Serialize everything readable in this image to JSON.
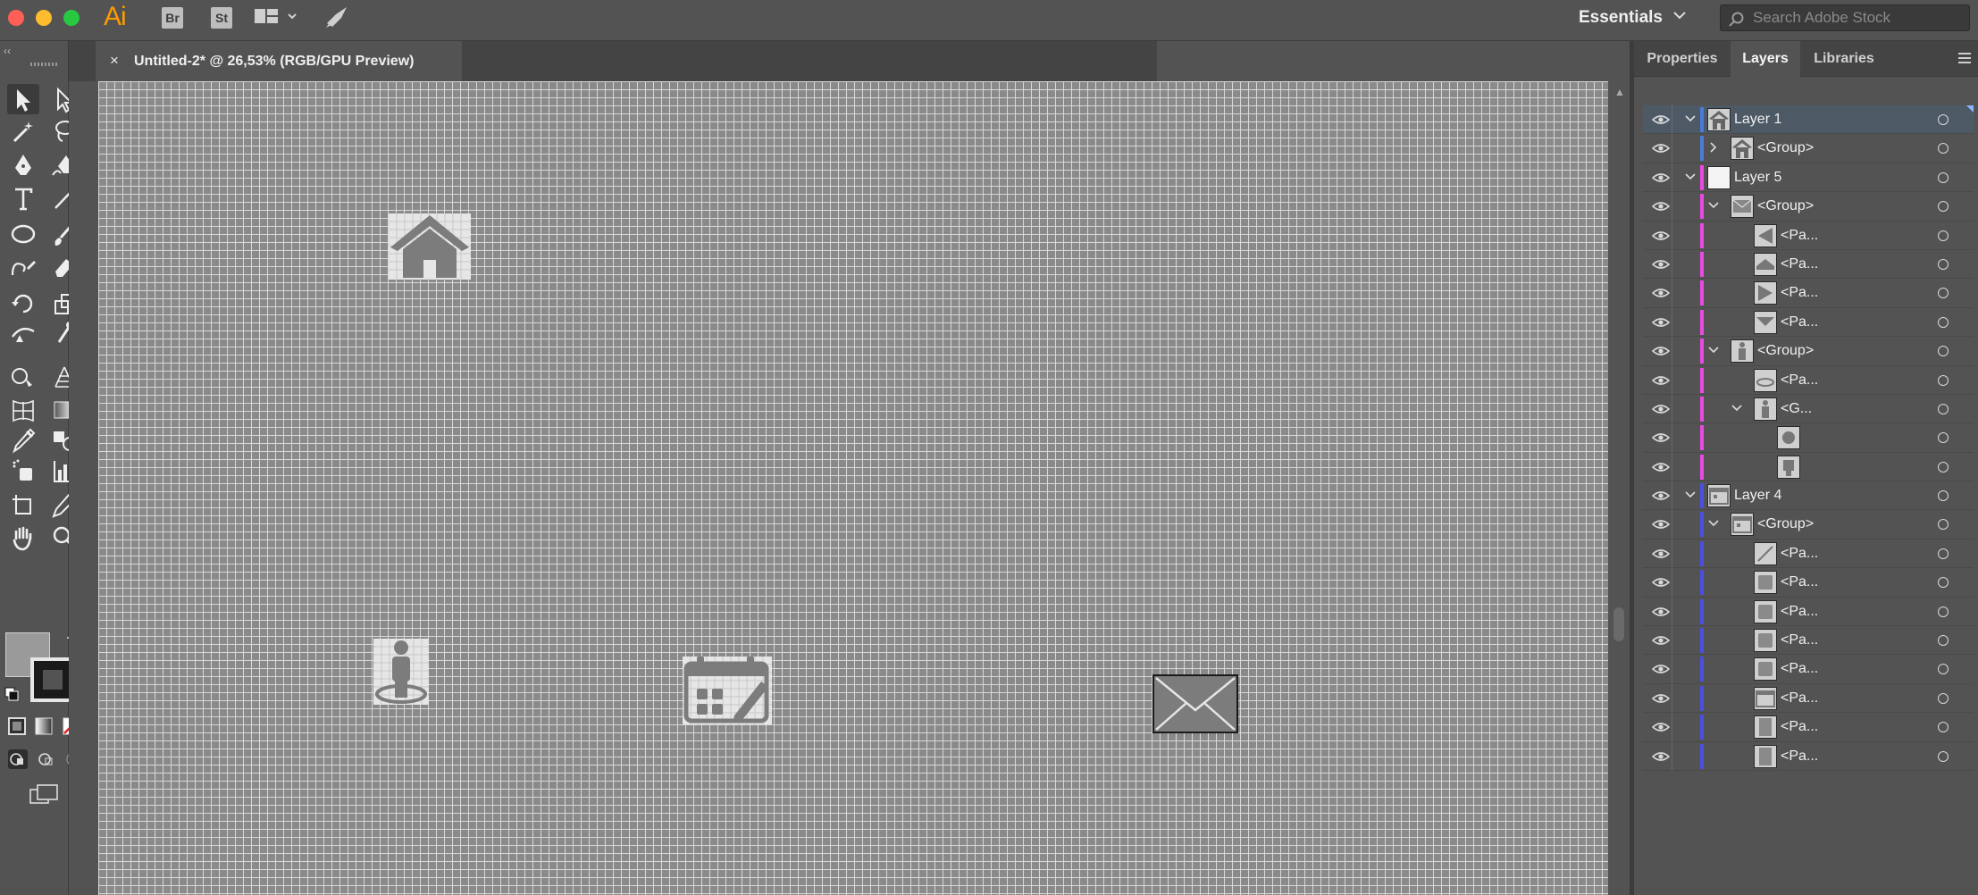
{
  "app": {
    "logo": "Ai",
    "bridge_label": "Br",
    "stock_label": "St",
    "arrange_icon": "arrange-documents-icon",
    "gpu_icon": "gpu-performance-icon"
  },
  "workspace": {
    "label": "Essentials"
  },
  "search": {
    "placeholder": "Search Adobe Stock"
  },
  "document": {
    "tab_title": "Untitled-2* @ 26,53% (RGB/GPU Preview)",
    "close_glyph": "×"
  },
  "toolbar": {
    "collapse_glyph": "‹‹",
    "tools": [
      "selection-tool-icon",
      "direct-selection-tool-icon",
      "magic-wand-tool-icon",
      "lasso-tool-icon",
      "pen-tool-icon",
      "curvature-tool-icon",
      "type-tool-icon",
      "line-segment-tool-icon",
      "ellipse-tool-icon",
      "paintbrush-tool-icon",
      "shaper-tool-icon",
      "eraser-tool-icon",
      "rotate-tool-icon",
      "scale-tool-icon",
      "width-tool-icon",
      "puppet-warp-tool-icon",
      "shape-builder-tool-icon",
      "perspective-grid-tool-icon",
      "mesh-tool-icon",
      "gradient-tool-icon",
      "eyedropper-tool-icon",
      "blend-tool-icon",
      "symbol-sprayer-tool-icon",
      "column-graph-tool-icon",
      "artboard-tool-icon",
      "slice-tool-icon",
      "hand-tool-icon",
      "zoom-tool-icon"
    ]
  },
  "colors": {
    "layer1": "#4a7bd8",
    "layer5": "#e74be0",
    "layer4": "#4b4fe0",
    "canvas_grid": "#d8d8d8",
    "selected_row": "#4d5a66"
  },
  "panel": {
    "tabs": [
      "Properties",
      "Layers",
      "Libraries"
    ],
    "active_tab": "Layers"
  },
  "layers": [
    {
      "name": "Layer 1",
      "level": 0,
      "twist": "expanded",
      "thumb": "house",
      "color": "#4a7bd8",
      "selected": true
    },
    {
      "name": "<Group>",
      "level": 1,
      "twist": "collapsed",
      "thumb": "house",
      "color": "#4a7bd8"
    },
    {
      "name": "Layer 5",
      "level": 0,
      "twist": "expanded",
      "thumb": "blank",
      "color": "#e74be0"
    },
    {
      "name": "<Group>",
      "level": 1,
      "twist": "expanded",
      "thumb": "envelope",
      "color": "#e74be0"
    },
    {
      "name": "<Pa...",
      "level": 2,
      "twist": "none",
      "thumb": "tri-left",
      "color": "#e74be0"
    },
    {
      "name": "<Pa...",
      "level": 2,
      "twist": "none",
      "thumb": "tri-top",
      "color": "#e74be0"
    },
    {
      "name": "<Pa...",
      "level": 2,
      "twist": "none",
      "thumb": "tri-right",
      "color": "#e74be0"
    },
    {
      "name": "<Pa...",
      "level": 2,
      "twist": "none",
      "thumb": "tri-bottom",
      "color": "#e74be0"
    },
    {
      "name": "<Group>",
      "level": 1,
      "twist": "expanded",
      "thumb": "person",
      "color": "#e74be0"
    },
    {
      "name": "<Pa...",
      "level": 2,
      "twist": "none",
      "thumb": "ring",
      "color": "#e74be0"
    },
    {
      "name": "<G...",
      "level": 2,
      "twist": "expanded",
      "thumb": "person",
      "color": "#e74be0"
    },
    {
      "name": "",
      "level": 3,
      "twist": "none",
      "thumb": "circle",
      "color": "#e74be0"
    },
    {
      "name": "",
      "level": 3,
      "twist": "none",
      "thumb": "body",
      "color": "#e74be0"
    },
    {
      "name": "Layer 4",
      "level": 0,
      "twist": "expanded",
      "thumb": "calendar",
      "color": "#4b4fe0"
    },
    {
      "name": "<Group>",
      "level": 1,
      "twist": "expanded",
      "thumb": "calendar",
      "color": "#4b4fe0"
    },
    {
      "name": "<Pa...",
      "level": 2,
      "twist": "none",
      "thumb": "pencil",
      "color": "#4b4fe0"
    },
    {
      "name": "<Pa...",
      "level": 2,
      "twist": "none",
      "thumb": "square",
      "color": "#4b4fe0"
    },
    {
      "name": "<Pa...",
      "level": 2,
      "twist": "none",
      "thumb": "square",
      "color": "#4b4fe0"
    },
    {
      "name": "<Pa...",
      "level": 2,
      "twist": "none",
      "thumb": "square",
      "color": "#4b4fe0"
    },
    {
      "name": "<Pa...",
      "level": 2,
      "twist": "none",
      "thumb": "square",
      "color": "#4b4fe0"
    },
    {
      "name": "<Pa...",
      "level": 2,
      "twist": "none",
      "thumb": "cal-top",
      "color": "#4b4fe0"
    },
    {
      "name": "<Pa...",
      "level": 2,
      "twist": "none",
      "thumb": "tab",
      "color": "#4b4fe0"
    },
    {
      "name": "<Pa...",
      "level": 2,
      "twist": "none",
      "thumb": "tab",
      "color": "#4b4fe0"
    }
  ]
}
